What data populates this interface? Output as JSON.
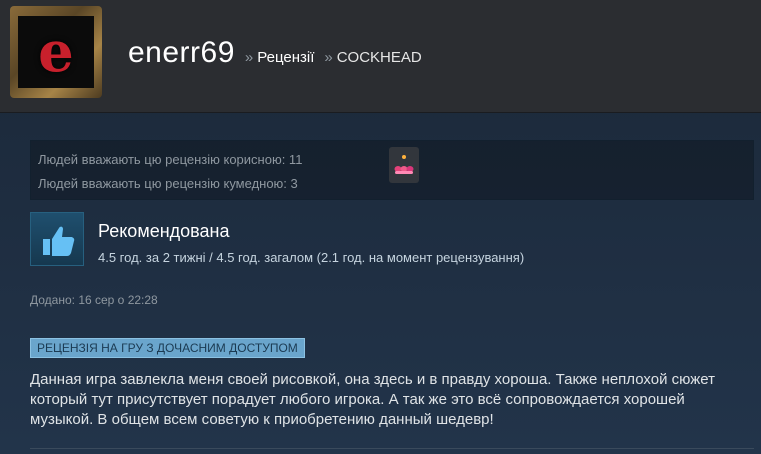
{
  "header": {
    "avatar_letter": "e",
    "username": "enerr69",
    "separator": "»",
    "breadcrumb_reviews": "Рецензії",
    "breadcrumb_game": "COCKHEAD"
  },
  "ratings": {
    "helpful": "Людей вважають цю рецензію корисною: 11",
    "funny": "Людей вважають цю рецензію кумедною: 3"
  },
  "recommendation": {
    "title": "Рекомендована",
    "hours": "4.5 год. за 2 тижні / 4.5 год. загалом (2.1 год. на момент рецензування)"
  },
  "posted": "Додано: 16 сер о 22:28",
  "early_access_badge": "РЕЦЕНЗІЯ НА ГРУ З ДОЧАСНИМ ДОСТУПОМ",
  "review_text": "Данная игра завлекла меня своей рисовкой, она здесь и в правду хороша. Также неплохой сюжет который тут присутствует порадует любого игрока. А так же это всё сопровождается хорошей музыкой. В общем всем советую к приобретению данный шедевр!",
  "icons": {
    "award": "award-icon",
    "thumb": "thumbs-up-icon"
  },
  "colors": {
    "background": "#1b2838",
    "header": "#2b2d31",
    "badge": "#6aa5cc",
    "avatar_letter": "#c8202c"
  }
}
